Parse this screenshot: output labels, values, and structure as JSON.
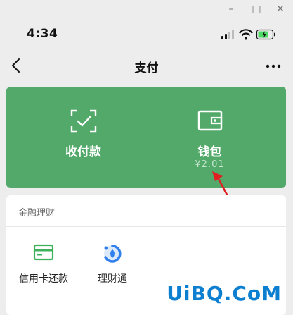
{
  "window": {
    "minimize_label": "–",
    "maximize_label": "□",
    "close_label": "✕"
  },
  "status_bar": {
    "time": "4:34"
  },
  "nav": {
    "title": "支付"
  },
  "payment_card": {
    "receive_pay_label": "收付款",
    "wallet_label": "钱包",
    "wallet_balance": "¥2.01"
  },
  "finance": {
    "section_title": "金融理财",
    "items": [
      {
        "label": "信用卡还款",
        "icon": "credit-card-icon"
      },
      {
        "label": "理财通",
        "icon": "wealth-management-icon"
      }
    ]
  },
  "colors": {
    "card_green": "#53a96a",
    "battery_green": "#4cd964",
    "icon_green": "#3fb15c",
    "icon_blue": "#2f80ed",
    "annotation_red": "#e02020",
    "watermark_blue": "#0d7fd0"
  },
  "watermark": {
    "text": "UiBQ.CoM"
  }
}
